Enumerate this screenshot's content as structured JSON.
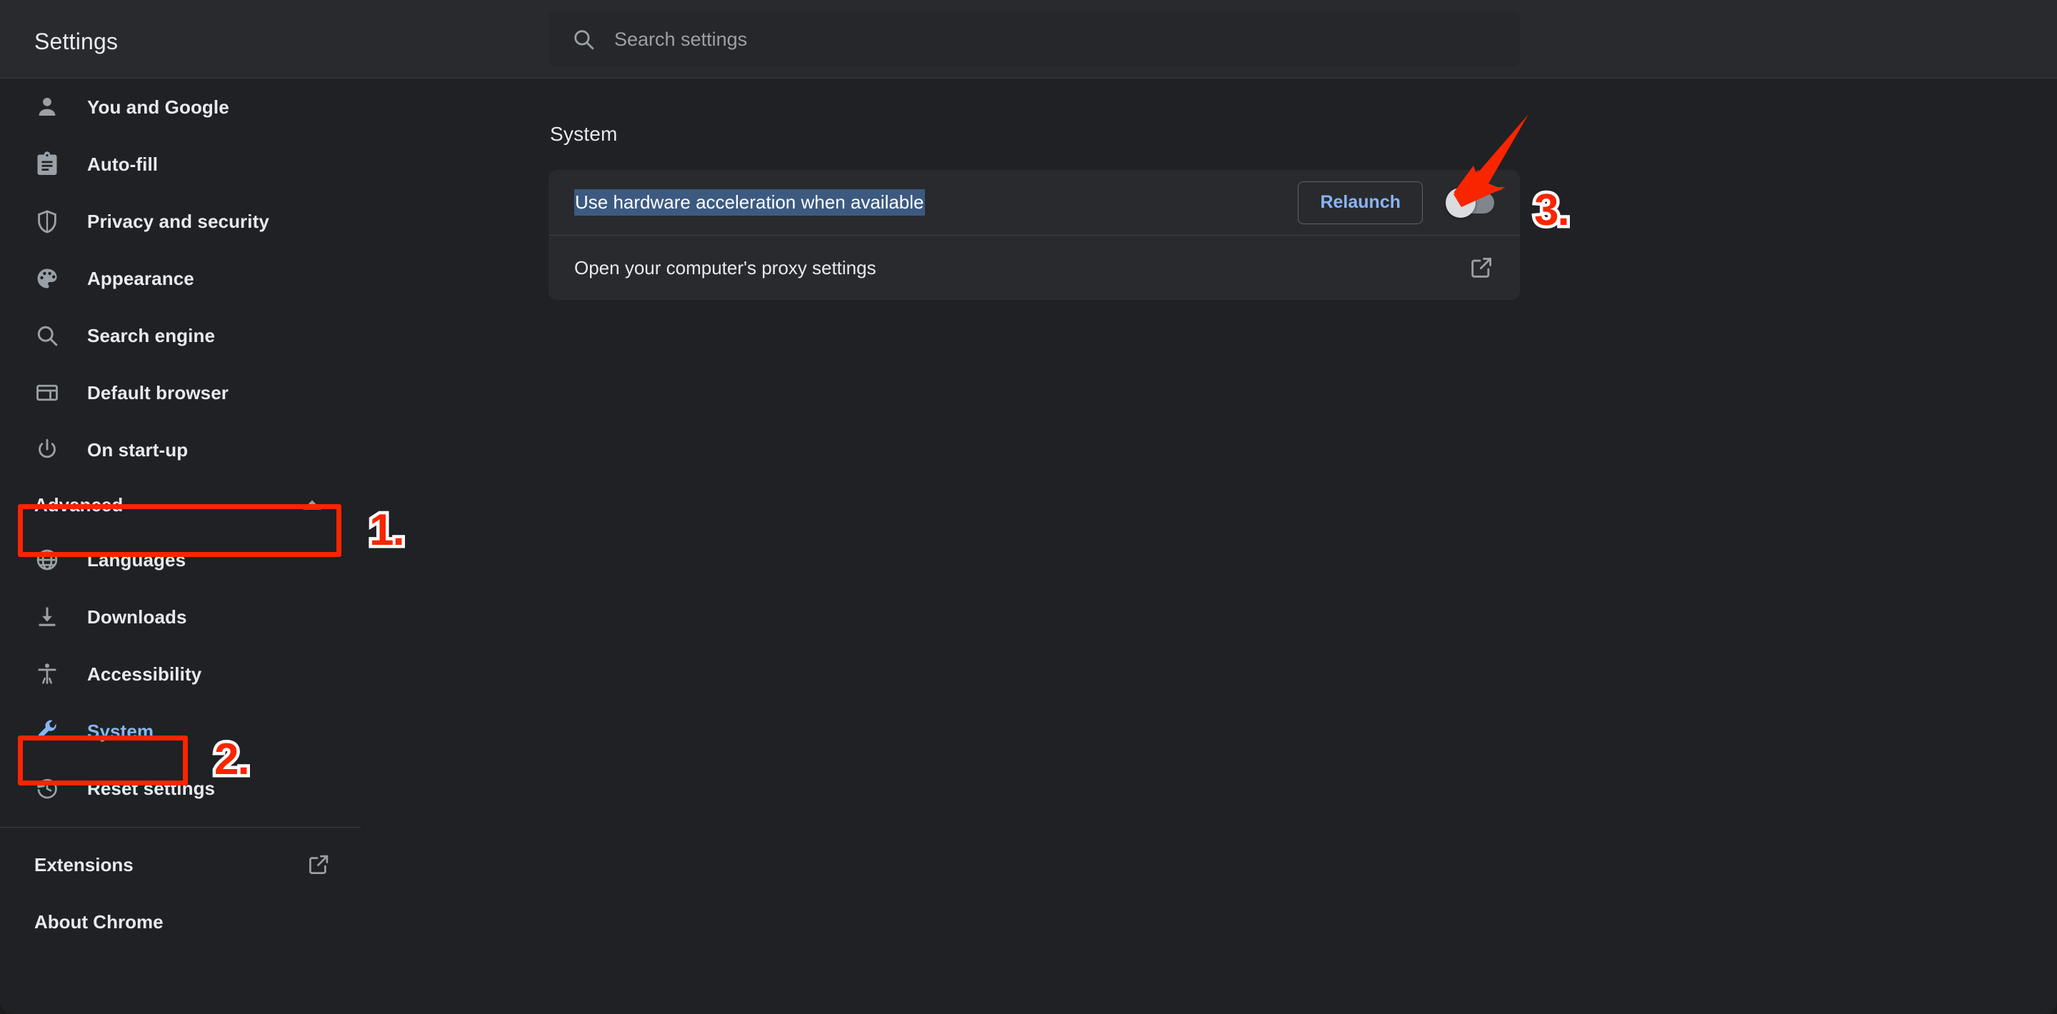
{
  "header": {
    "title": "Settings",
    "search_placeholder": "Search settings",
    "search_value": "",
    "search_icon": "search-icon"
  },
  "sidebar": {
    "primary_items": [
      {
        "label": "You and Google",
        "icon": "person-icon"
      },
      {
        "label": "Auto-fill",
        "icon": "clipboard-icon"
      },
      {
        "label": "Privacy and security",
        "icon": "shield-icon"
      },
      {
        "label": "Appearance",
        "icon": "palette-icon"
      },
      {
        "label": "Search engine",
        "icon": "search-icon"
      },
      {
        "label": "Default browser",
        "icon": "browser-window-icon"
      },
      {
        "label": "On start-up",
        "icon": "power-icon"
      }
    ],
    "advanced": {
      "label": "Advanced",
      "expanded": true,
      "chevron_icon": "chevron-up-icon"
    },
    "advanced_items": [
      {
        "label": "Languages",
        "icon": "globe-icon",
        "active": false
      },
      {
        "label": "Downloads",
        "icon": "download-icon",
        "active": false
      },
      {
        "label": "Accessibility",
        "icon": "accessibility-icon",
        "active": false
      },
      {
        "label": "System",
        "icon": "wrench-icon",
        "active": true
      },
      {
        "label": "Reset settings",
        "icon": "history-restore-icon",
        "active": false
      }
    ],
    "footer_items": [
      {
        "label": "Extensions",
        "external_icon": "external-link-icon"
      },
      {
        "label": "About Chrome",
        "external_icon": ""
      }
    ]
  },
  "main": {
    "section_title": "System",
    "rows": [
      {
        "label": "Use hardware acceleration when available",
        "label_selected": true,
        "button_label": "Relaunch",
        "toggle_state": "off",
        "toggle_name": "hardware-acceleration-toggle"
      },
      {
        "label": "Open your computer's proxy settings",
        "label_selected": false,
        "external_icon": "external-link-icon"
      }
    ]
  },
  "annotations": {
    "color": "#f92500",
    "outline": "#ffffff",
    "steps": [
      {
        "number": "1.",
        "target": "advanced-section-header"
      },
      {
        "number": "2.",
        "target": "sidebar-item-system"
      },
      {
        "number": "3.",
        "target": "hardware-acceleration-toggle"
      }
    ],
    "arrow": {
      "points_to": "hardware-acceleration-toggle"
    }
  },
  "colors": {
    "page_background": "#202124",
    "header_background": "#292a2d",
    "card_background": "#292a2d",
    "accent_blue": "#8ab4f8",
    "text_primary": "#e8eaed",
    "text_secondary": "#9aa0a6",
    "selection_blue": "#3c5a80",
    "annotation_red": "#f92500"
  }
}
